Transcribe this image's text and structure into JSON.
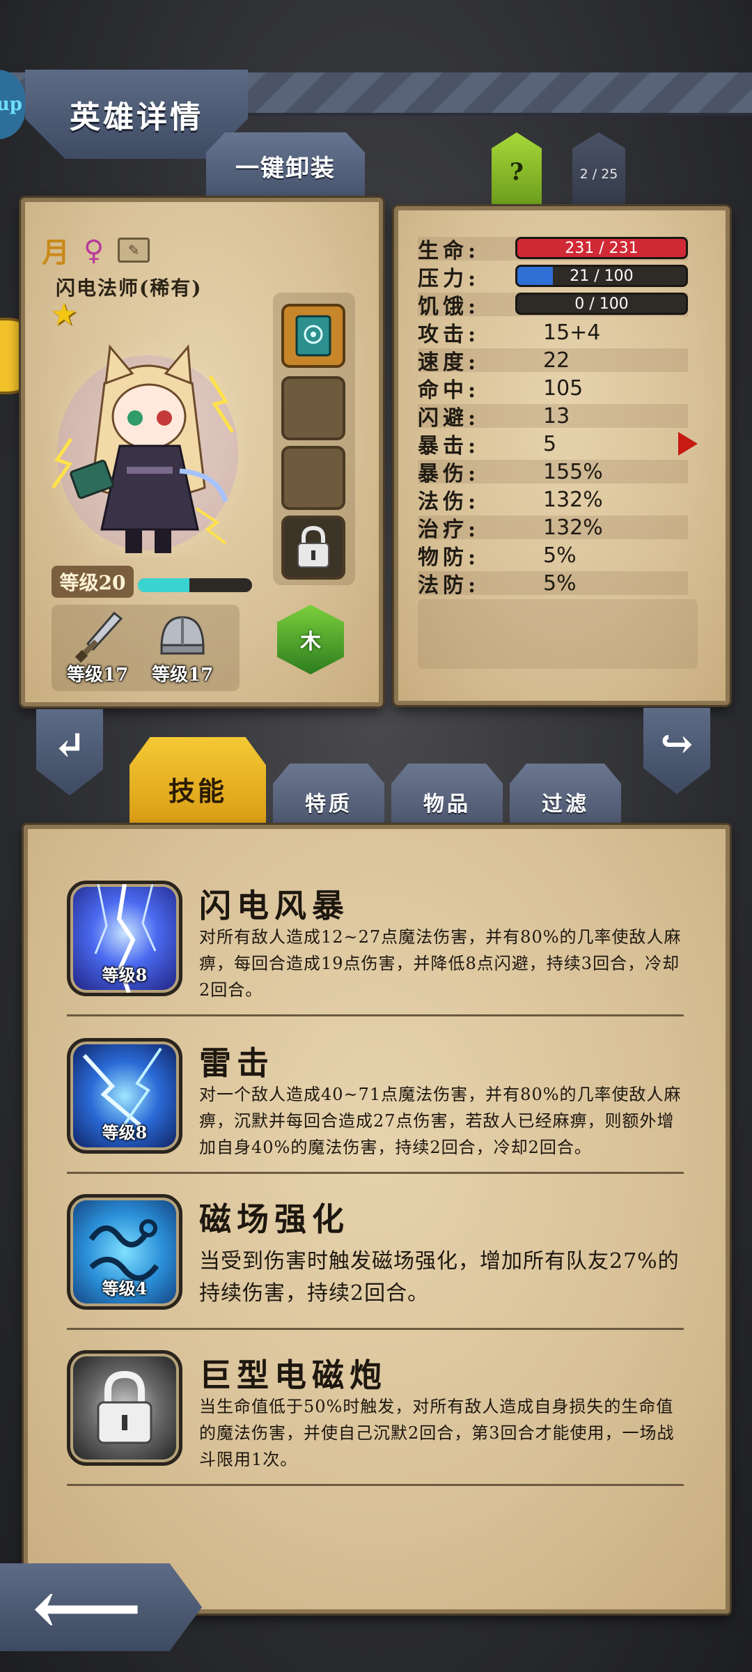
{
  "header": {
    "title": "英雄详情",
    "side_badge": "up",
    "unequip_label": "一键卸装",
    "help_label": "?",
    "hero_count": "2 / 25"
  },
  "hero": {
    "moon_glyph": "月",
    "gender_glyph": "♀",
    "edit_glyph": "✎",
    "name": "闪电法师(稀有)",
    "star_glyph": "★",
    "level_label": "等级20",
    "xp_progress": 0.45,
    "weapon_level": "等级17",
    "helmet_level": "等级17",
    "element": "木"
  },
  "stats": {
    "hp": {
      "label": "生命:",
      "text": "231 / 231",
      "fraction": 1.0,
      "color": "#d02a36"
    },
    "stress": {
      "label": "压力:",
      "text": "21 / 100",
      "fraction": 0.21,
      "color": "#2f6fd6"
    },
    "hunger": {
      "label": "饥饿:",
      "text": "0 / 100",
      "fraction": 0.0,
      "color": "#888888"
    },
    "rows": [
      {
        "label": "攻击:",
        "value": "15+4"
      },
      {
        "label": "速度:",
        "value": "22"
      },
      {
        "label": "命中:",
        "value": "105"
      },
      {
        "label": "闪避:",
        "value": "13"
      },
      {
        "label": "暴击:",
        "value": "5"
      },
      {
        "label": "暴伤:",
        "value": "155%"
      },
      {
        "label": "法伤:",
        "value": "132%"
      },
      {
        "label": "治疗:",
        "value": "132%"
      },
      {
        "label": "物防:",
        "value": "5%"
      },
      {
        "label": "法防:",
        "value": "5%"
      }
    ]
  },
  "tabs": [
    {
      "label": "技能",
      "active": true
    },
    {
      "label": "特质",
      "active": false
    },
    {
      "label": "物品",
      "active": false
    },
    {
      "label": "过滤",
      "active": false
    }
  ],
  "skills": [
    {
      "name": "闪电风暴",
      "level": "等级8",
      "icon": "lightning-storm-icon",
      "description": "对所有敌人造成12~27点魔法伤害，并有80%的几率使敌人麻痹，每回合造成19点伤害，并降低8点闪避，持续3回合，冷却2回合。"
    },
    {
      "name": "雷击",
      "level": "等级8",
      "icon": "thunder-strike-icon",
      "description": "对一个敌人造成40~71点魔法伤害，并有80%的几率使敌人麻痹，沉默并每回合造成27点伤害，若敌人已经麻痹，则额外增加自身40%的魔法伤害，持续2回合，冷却2回合。"
    },
    {
      "name": "磁场强化",
      "level": "等级4",
      "icon": "magnetic-field-icon",
      "description": "当受到伤害时触发磁场强化，增加所有队友27%的持续伤害，持续2回合。"
    },
    {
      "name": "巨型电磁炮",
      "level": "",
      "icon": "lock-icon",
      "description": "当生命值低于50%时触发，对所有敌人造成自身损失的生命值的魔法伤害，并使自己沉默2回合，第3回合才能使用，一场战斗限用1次。"
    }
  ],
  "nav": {
    "prev_glyph": "↵",
    "next_glyph": "↪",
    "back_glyph": "⟵"
  }
}
